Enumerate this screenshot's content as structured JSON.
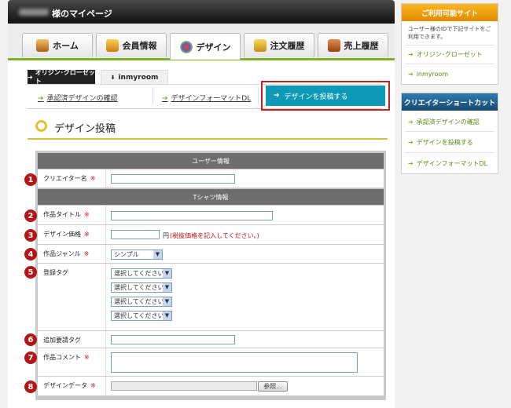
{
  "header": {
    "title": "様のマイページ"
  },
  "nav": {
    "tabs": [
      {
        "label": "ホーム",
        "icon": "house-icon"
      },
      {
        "label": "会員情報",
        "icon": "member-card-icon"
      },
      {
        "label": "デザイン",
        "icon": "paint-palette-icon"
      },
      {
        "label": "注文履歴",
        "icon": "box-icon"
      },
      {
        "label": "売上履歴",
        "icon": "cash-register-icon"
      }
    ],
    "active_tab": "デザイン"
  },
  "site_tabs": [
    {
      "label": "オリジン･クローゼット",
      "prefix": "➔"
    },
    {
      "label": "inmyroom",
      "prefix": "⬇"
    }
  ],
  "sub_links": [
    {
      "label": "承認済デザインの確認"
    },
    {
      "label": "デザインフォーマットDL"
    }
  ],
  "post_button": {
    "label": "デザインを投稿する"
  },
  "page_title": "デザイン投稿",
  "form": {
    "section_user": "ユーザー情報",
    "section_shirt": "Tシャツ情報",
    "creator_label": "クリエイター名",
    "title_label": "作品タイトル",
    "price_label": "デザイン価格",
    "price_unit": "円",
    "price_note": "(税抜価格を記入してください。)",
    "genre_label": "作品ジャンル",
    "genre_value": "シンプル",
    "tags_label": "登録タグ",
    "tag_placeholder": "選択してください",
    "extra_tag_label": "追加要請タグ",
    "comment_label": "作品コメント",
    "data_label": "デザインデータ",
    "browse_label": "参照...",
    "required_mark": "※",
    "badges": [
      "1",
      "2",
      "3",
      "4",
      "5",
      "6",
      "7",
      "8"
    ]
  },
  "sidebar": {
    "services": {
      "title": "ご利用可能サイト",
      "desc": "ユーザー様のIDで下記サイトをご利用できます。",
      "links": [
        "オリジン･クローゼット",
        "inmyroom"
      ]
    },
    "shortcuts": {
      "title": "クリエイターショートカット",
      "links": [
        "承認済デザインの確認",
        "デザインを投稿する",
        "デザインフォーマットDL"
      ]
    }
  },
  "colors": {
    "accent_green": "#7fb229",
    "post_button": "#0e9ab6",
    "highlight_red": "#c82020",
    "badge_red": "#b41616",
    "services_header": "#f4a200",
    "shortcut_header": "#1f5f8b"
  }
}
